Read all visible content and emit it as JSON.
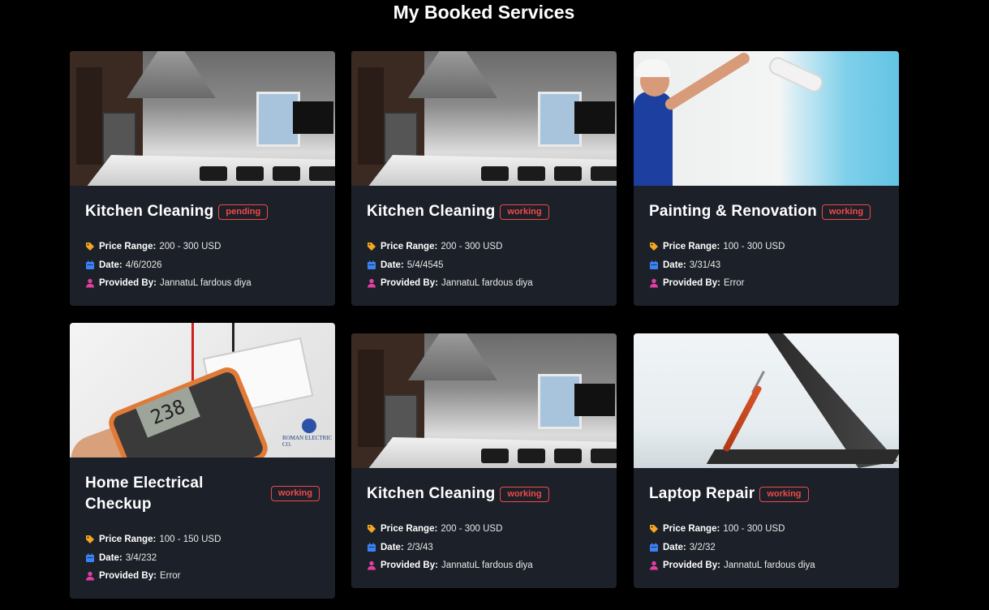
{
  "page_title": "My Booked Services",
  "labels": {
    "price": "Price Range:",
    "date": "Date:",
    "provider": "Provided By:"
  },
  "colors": {
    "badge": "#ef4a4a",
    "price_icon": "#f5a623",
    "date_icon": "#3b82f6",
    "provider_icon": "#e040a0",
    "card_bg": "#1c2028"
  },
  "cards": [
    {
      "title": "Kitchen Cleaning",
      "status": "pending",
      "price": "200 - 300 USD",
      "date": "4/6/2026",
      "provider": "JannatuL fardous diya",
      "image": "kitchen-photo"
    },
    {
      "title": "Kitchen Cleaning",
      "status": "working",
      "price": "200 - 300 USD",
      "date": "5/4/4545",
      "provider": "JannatuL fardous diya",
      "image": "kitchen-photo"
    },
    {
      "title": "Painting & Renovation",
      "status": "working",
      "price": "100 - 300 USD",
      "date": "3/31/43",
      "provider": "Error",
      "image": "painter-photo"
    },
    {
      "title": "Home Electrical Checkup",
      "status": "working",
      "price": "100 - 150 USD",
      "date": "3/4/232",
      "provider": "Error",
      "image": "multimeter-photo",
      "image_text": "ROMAN ELECTRIC CO.",
      "meter_reading": "238"
    },
    {
      "title": "Kitchen Cleaning",
      "status": "working",
      "price": "200 - 300 USD",
      "date": "2/3/43",
      "provider": "JannatuL fardous diya",
      "image": "kitchen-photo"
    },
    {
      "title": "Laptop Repair",
      "status": "working",
      "price": "100 - 300 USD",
      "date": "3/2/32",
      "provider": "JannatuL fardous diya",
      "image": "laptop-repair-photo"
    }
  ]
}
